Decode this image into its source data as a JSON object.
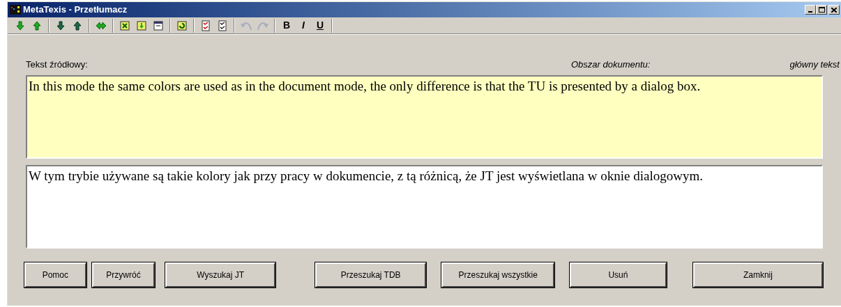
{
  "window": {
    "title": "MetaTexis - Przetłumacz"
  },
  "toolbar": [
    {
      "kind": "green-down",
      "disabled": false
    },
    {
      "kind": "green-up",
      "disabled": false
    },
    {
      "kind": "sep"
    },
    {
      "kind": "dark-down",
      "disabled": false
    },
    {
      "kind": "dark-up",
      "disabled": false
    },
    {
      "kind": "sep"
    },
    {
      "kind": "swap",
      "disabled": false
    },
    {
      "kind": "sep"
    },
    {
      "kind": "doc-star",
      "disabled": false
    },
    {
      "kind": "doc-down",
      "disabled": false
    },
    {
      "kind": "doc-bar",
      "disabled": false
    },
    {
      "kind": "sep"
    },
    {
      "kind": "doc-refresh",
      "disabled": false
    },
    {
      "kind": "sep"
    },
    {
      "kind": "check-red",
      "disabled": false
    },
    {
      "kind": "check-dark",
      "disabled": false
    },
    {
      "kind": "sep"
    },
    {
      "kind": "undo",
      "disabled": true
    },
    {
      "kind": "redo",
      "disabled": true
    },
    {
      "kind": "sep"
    },
    {
      "kind": "text",
      "label": "B",
      "disabled": false
    },
    {
      "kind": "text",
      "label": "I",
      "disabled": false
    },
    {
      "kind": "text",
      "label": "U",
      "disabled": false
    },
    {
      "kind": "sep"
    }
  ],
  "source_label": "Tekst źródłowy:",
  "area_label": "Obszar dokumentu:",
  "area_value": "główny tekst",
  "source_text": "In this mode the same colors are used as in the document mode, the only difference is that the TU is presented by a dialog box.",
  "target_text": "W tym trybie używane są takie kolory jak przy pracy w dokumencie, z tą różnicą, że JT jest wyświetlana w oknie dialogowym.",
  "buttons": [
    {
      "label": "Pomoc"
    },
    {
      "label": "Przywróć"
    },
    {
      "label": "Wyszukaj JT"
    },
    {
      "label": "Przeszukaj TDB"
    },
    {
      "label": "Przeszukaj wszystkie"
    },
    {
      "label": "Usuń"
    },
    {
      "label": "Zamknij"
    }
  ]
}
